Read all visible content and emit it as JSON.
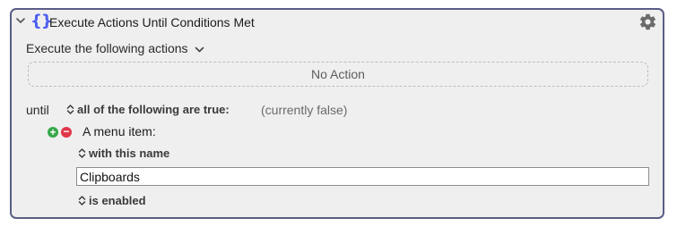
{
  "action": {
    "title": "Execute Actions Until Conditions Met",
    "braces_icon": "{}",
    "execute_label": "Execute the following actions",
    "no_action_label": "No Action"
  },
  "condition": {
    "until_label": "until",
    "mode_label": "all of the following are true:",
    "status_text": "(currently false)",
    "add_symbol": "+",
    "remove_symbol": "−",
    "menu_item_label": "A menu item:",
    "name_match_label": "with this name",
    "name_value": "Clipboards",
    "state_label": "is enabled"
  },
  "colors": {
    "border": "#5a5e85",
    "braces": "#4d5ff0",
    "add": "#37a84a",
    "remove": "#e0374a"
  }
}
